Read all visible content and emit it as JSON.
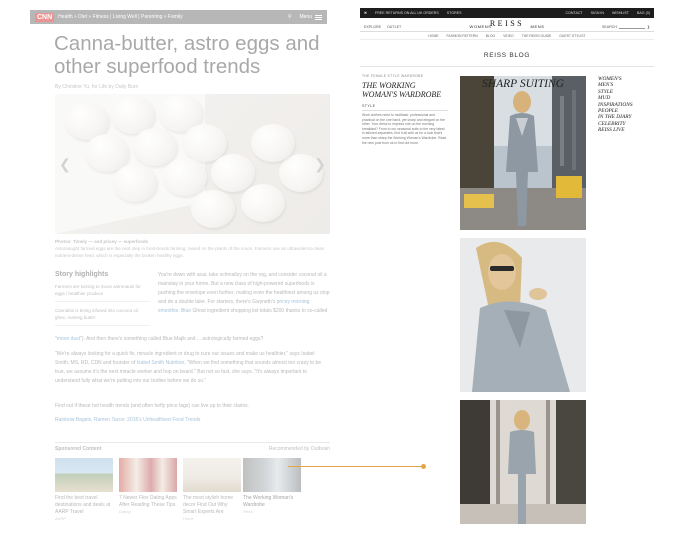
{
  "left_page": {
    "brand": "CNN",
    "nav": "Health » Diet » Fitness | Living Well | Parenting » Family",
    "menu_label": "Menu",
    "headline": "Canna-butter, astro eggs and other superfood trends",
    "byline": "By Christine Yu, for Life by Daily Burn",
    "caption": "Photos: Timely — and pricey — superfoods",
    "caption_body": "Astronaught farmed eggs are the next step in food-trends farming; raised on the plants of the moon. Farmers use an ultraviolet-to-clean nutrient-dense feed, which is especially the broken healthy eggs.",
    "story_highlights": {
      "title": "Story highlights",
      "items": [
        "Farmers are turning to moon astronauts for eggs / healthier produce",
        "Cannabis is being infused into coconut oil, ghee, nutmeg butter"
      ]
    },
    "body_intro": "You're down with acai, take schmaltzy on the reg, and consider coconut oil a mainstay in your home. But a new class of high-powered superfoods is pushing the envelope even further, rivaling even the healthiest among us stop and do a double take. For starters, there's Gwyneth's",
    "body_link1": "pricey morning smoothie.",
    "body_link2": "Blue",
    "body_mid": "Ghost ingredient shopping list totals $200 thanks to so-called",
    "body_link3": "moon dust",
    "body_after": "). And then there's something called Blue Majik and ... astrologically farmed eggs?",
    "quote_before": "\"We're always looking for a quick fix, miracle ingredient or drug to cure our issues and make us healthier,\" says Isabel Smith, MS, RD, CDN and founder of",
    "quote_link": "Isabel Smith Nutrition",
    "quote_after": ". \"When we find something that sounds almost too crazy to be true, we assume it's the next miracle worker and hop on board.\" But not so fast, she says. \"It's always important to understand fully what we're putting into our bodies before we do so.\"",
    "line_find": "Find out if these hot health trends (and often hefty price tags) can live up to their claims.",
    "link_related": "Rainbow Bagels, Ramen Tacos: 2016's Unhealthiest Food Trends",
    "sponsored_label": "Sponsored Content",
    "sponsored_by": "Recommended by Outbrain",
    "sponsored_cards": [
      {
        "title": "Find the best travel destinations and deals at AARP Travel",
        "source": "AARP"
      },
      {
        "title": "7 Newer Flex Dating Apps After Reading These Tips",
        "source": "Dating"
      },
      {
        "title": "The most stylish home decor Find Out Why Smart Experts Are",
        "source": "Home"
      },
      {
        "title": "The Working Woman's Wardrobe",
        "source": "Reiss"
      }
    ]
  },
  "right_page": {
    "topbar": {
      "region": "FREE RETURNS ON ALL UK ORDERS",
      "stores": "STORES",
      "links": [
        "CONTACT",
        "SIGN IN",
        "WISHLIST",
        "BAG (0)"
      ]
    },
    "logo": "REISS",
    "gender_nav": [
      "WOMENS",
      "MENS"
    ],
    "left_links": [
      "EXPLORE",
      "OUTLET"
    ],
    "search_label": "SEARCH",
    "subnav": [
      "HOME",
      "FASHION PATTERN",
      "BLOG",
      "VIDEO",
      "THE REISS GUIDE",
      "GUEST STYLIST"
    ],
    "blog_title": "REISS BLOG",
    "post_meta": "THE FEMALE STYLE WARDROBE",
    "post_title": "THE WORKING WOMAN'S WARDROBE",
    "section_head": "STYLE",
    "post_text": "Work clothes need to multitask: professional and practical on the one hand, yet sharp and elegant on the other. Your dress to impress role on the morning breakfast? From to our seasonal suits to the very latest in tailored separates, find it all with us for a look that's more than sharp the Working Woman's Wardrobe. Read the new post from us to find out more.",
    "photo_title": "SHARP SUITING",
    "categories": [
      "WOMEN'S",
      "MEN'S",
      "STYLE",
      "MUD",
      "INSPIRATIONS",
      "PEOPLE",
      "IN THE DIARY",
      "CELEBRITY",
      "REISS LIVE"
    ]
  },
  "colors": {
    "connector": "#e5a44a",
    "link": "#2a6ea8",
    "cnn_red": "#cc0000"
  }
}
